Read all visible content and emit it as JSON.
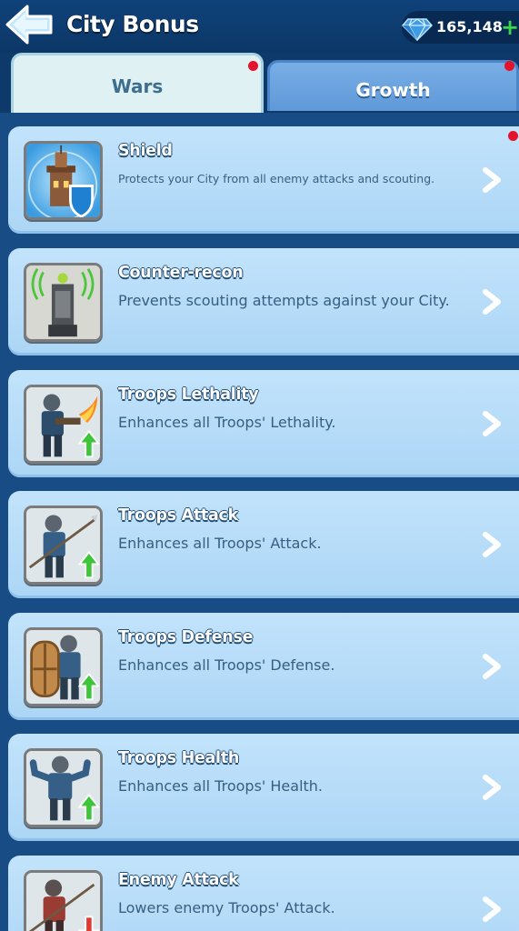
{
  "header": {
    "title": "City Bonus",
    "back_icon": "arrow-left-icon",
    "currency_icon": "diamond-gem-icon",
    "currency_value": "165,148",
    "add_icon": "plus-icon",
    "add_label": "+"
  },
  "tabs": [
    {
      "label": "Wars",
      "active": true,
      "notification": true
    },
    {
      "label": "Growth",
      "active": false,
      "notification": true
    }
  ],
  "bonuses": [
    {
      "title": "Shield",
      "description": "Protects your City from all enemy attacks and scouting.",
      "icon": "shield-tower-icon",
      "notification": true
    },
    {
      "title": "Counter-recon",
      "description": "Prevents scouting attempts against your City.",
      "icon": "radar-tower-icon"
    },
    {
      "title": "Troops Lethality",
      "description": "Enhances all Troops' Lethality.",
      "icon": "flamethrower-soldier-icon",
      "arrow": "up"
    },
    {
      "title": "Troops Attack",
      "description": "Enhances all Troops' Attack.",
      "icon": "spear-soldier-icon",
      "arrow": "up"
    },
    {
      "title": "Troops Defense",
      "description": "Enhances all Troops' Defense.",
      "icon": "shield-soldier-icon",
      "arrow": "up"
    },
    {
      "title": "Troops Health",
      "description": "Enhances all Troops' Health.",
      "icon": "strong-soldier-icon",
      "arrow": "up"
    },
    {
      "title": "Enemy Attack",
      "description": "Lowers enemy Troops' Attack.",
      "icon": "enemy-soldier-icon",
      "arrow": "down"
    }
  ],
  "colors": {
    "background": "#0d3a6b",
    "row": "#b6dcf8",
    "notification": "#e3132b",
    "up_arrow": "#3ec63a",
    "down_arrow": "#e23a2e"
  }
}
